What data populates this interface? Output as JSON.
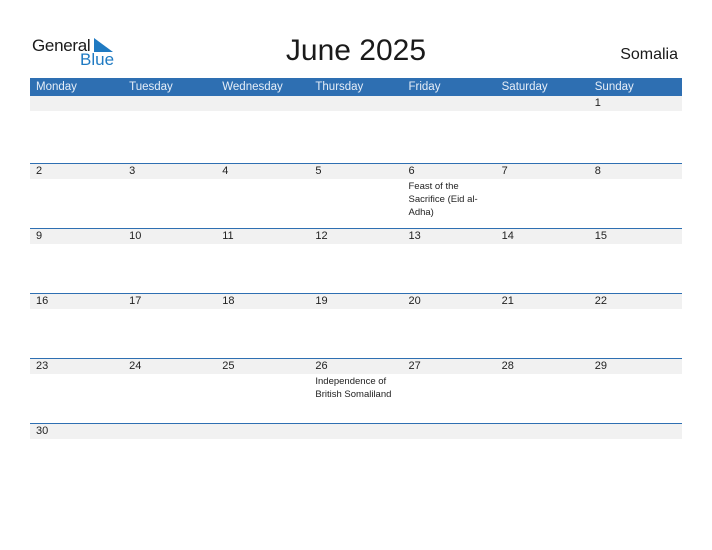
{
  "logo": {
    "general": "General",
    "blue": "Blue"
  },
  "title": "June 2025",
  "country": "Somalia",
  "colors": {
    "accent": "#2e6fb2",
    "day_bg": "#f1f1f1"
  },
  "weekdays": [
    "Monday",
    "Tuesday",
    "Wednesday",
    "Thursday",
    "Friday",
    "Saturday",
    "Sunday"
  ],
  "weeks": [
    {
      "days": [
        "",
        "",
        "",
        "",
        "",
        "",
        "1"
      ],
      "events": [
        "",
        "",
        "",
        "",
        "",
        "",
        ""
      ]
    },
    {
      "days": [
        "2",
        "3",
        "4",
        "5",
        "6",
        "7",
        "8"
      ],
      "events": [
        "",
        "",
        "",
        "",
        "Feast of the Sacrifice (Eid al-Adha)",
        "",
        ""
      ]
    },
    {
      "days": [
        "9",
        "10",
        "11",
        "12",
        "13",
        "14",
        "15"
      ],
      "events": [
        "",
        "",
        "",
        "",
        "",
        "",
        ""
      ]
    },
    {
      "days": [
        "16",
        "17",
        "18",
        "19",
        "20",
        "21",
        "22"
      ],
      "events": [
        "",
        "",
        "",
        "",
        "",
        "",
        ""
      ]
    },
    {
      "days": [
        "23",
        "24",
        "25",
        "26",
        "27",
        "28",
        "29"
      ],
      "events": [
        "",
        "",
        "",
        "Independence of British Somaliland",
        "",
        "",
        ""
      ]
    },
    {
      "days": [
        "30",
        "",
        "",
        "",
        "",
        "",
        ""
      ],
      "events": [
        "",
        "",
        "",
        "",
        "",
        "",
        ""
      ]
    }
  ]
}
